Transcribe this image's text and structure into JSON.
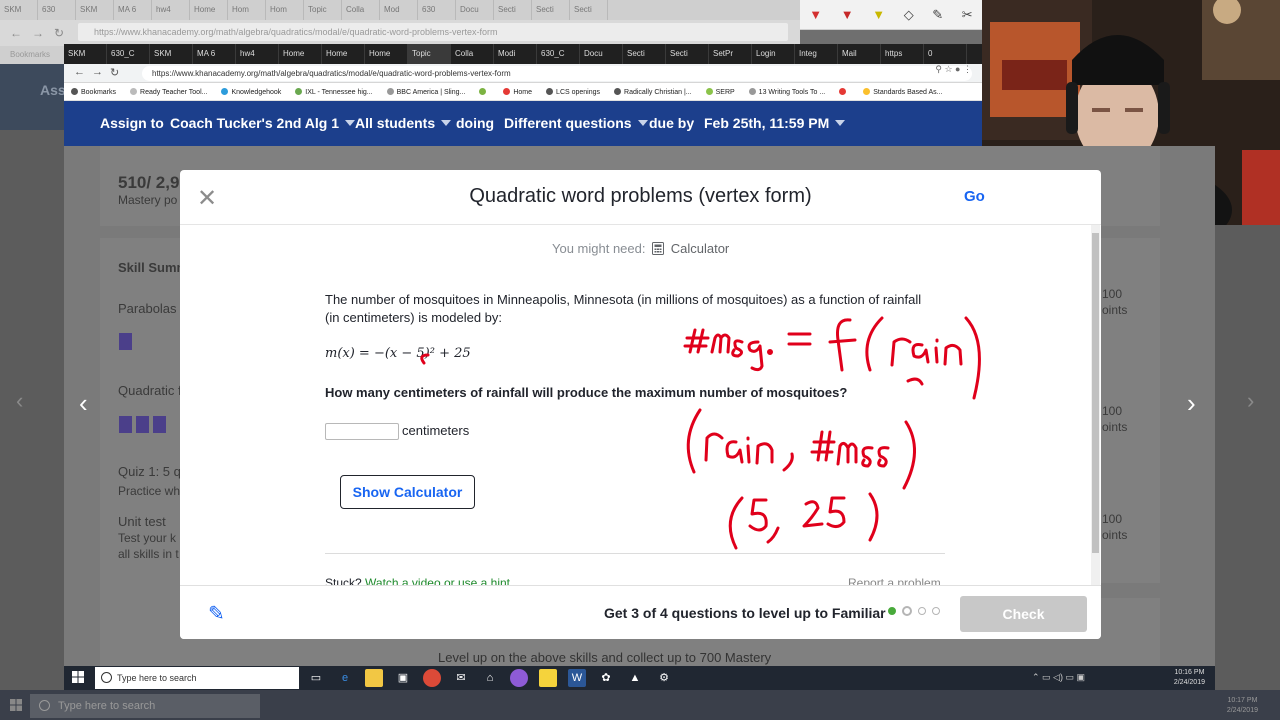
{
  "outer_browser": {
    "tabs": [
      "SKM",
      "630",
      "SKM",
      "MA 6",
      "hw4",
      "Home",
      "Hom",
      "Hom",
      "Topic",
      "Colla",
      "Mod",
      "630",
      "Docu",
      "Secti",
      "Secti",
      "Secti"
    ],
    "url": "https://www.khanacademy.org/math/algebra/quadratics/modal/e/quadratic-word-problems-vertex-form",
    "bookmarks_label": "Bookmarks",
    "left_logo_text": "Ass"
  },
  "browser": {
    "tabs": [
      "SKM",
      "630_C",
      "SKM",
      "MA 6",
      "hw4",
      "Home",
      "Home",
      "Home",
      "Topic",
      "Colla",
      "Modi",
      "630_C",
      "Docu",
      "Secti",
      "Secti",
      "SetPr",
      "Login",
      "Integ",
      "Mail",
      "https",
      "0"
    ],
    "url": "https://www.khanacademy.org/math/algebra/quadratics/modal/e/quadratic-word-problems-vertex-form",
    "bookmarks": [
      {
        "label": "Bookmarks",
        "color": "#555555"
      },
      {
        "label": "Ready Teacher Tool...",
        "color": "#bbbbbb"
      },
      {
        "label": "Knowledgehook",
        "color": "#2d9cdb"
      },
      {
        "label": "IXL - Tennessee hig...",
        "color": "#6aa84f"
      },
      {
        "label": "BBC America | Sling...",
        "color": "#999999"
      },
      {
        "label": "",
        "color": "#7cb342"
      },
      {
        "label": "Home",
        "color": "#e53935"
      },
      {
        "label": "LCS openings",
        "color": "#555555"
      },
      {
        "label": "Radically Christian |...",
        "color": "#555555"
      },
      {
        "label": "SERP",
        "color": "#8bc34a"
      },
      {
        "label": "13 Writing Tools To ...",
        "color": "#999999"
      },
      {
        "label": "",
        "color": "#e53935"
      },
      {
        "label": "Standards Based As...",
        "color": "#fbc02d"
      }
    ]
  },
  "assign_bar": {
    "assign_to": "Assign to",
    "class_name": "Coach Tucker's 2nd Alg 1",
    "students": "All students",
    "doing": "doing",
    "questions": "Different questions",
    "due_by": "due by",
    "due_date": "Feb 25th, 11:59 PM"
  },
  "background_page": {
    "mastery_points": "510/ 2,9",
    "mastery_sub": "Mastery po",
    "skill_summary": "Skill Summ",
    "parabolas": "Parabolas i",
    "quadratic": "Quadratic f",
    "quiz": "Quiz 1: 5 q",
    "quiz_sub": "Practice wh",
    "unit_test": "Unit test",
    "unit_test_sub1": "Test your k",
    "unit_test_sub2": "all skills in t",
    "right_pts": [
      "100",
      "oints",
      "100",
      "oints",
      "100",
      "oints"
    ],
    "level_up_text": "Level up on the above skills and collect up to 700 Mastery"
  },
  "modal": {
    "title": "Quadratic word problems (vertex form)",
    "go_label": "Go",
    "you_might_need": "You might need:",
    "calculator": "Calculator",
    "problem_text": "The number of mosquitoes in Minneapolis, Minnesota (in millions of mosquitoes) as a function of rainfall (in centimeters) is modeled by:",
    "formula_text": "m(x) = −(x − 5)² + 25",
    "question": "How many centimeters of rainfall will produce the maximum number of mosquitoes?",
    "answer_value": "",
    "unit": "centimeters",
    "show_calculator": "Show Calculator",
    "stuck": "Stuck?",
    "hint_link": "Watch a video or use a hint",
    "report": "Report a problem",
    "level_up": "Get 3 of 4 questions to level up to Familiar",
    "progress": {
      "completed": 1,
      "total": 4
    },
    "check": "Check"
  },
  "annotations": {
    "line1": "#mosq. = f(rain)",
    "line2": "(rain, #mosq)",
    "line3": "(5, 25)",
    "color": "#e0001b"
  },
  "taskbar": {
    "search_placeholder": "Type here to search",
    "time": "10:16 PM",
    "date": "2/24/2019",
    "outer_time": "10:17 PM",
    "outer_date": "2/24/2019"
  },
  "colors": {
    "khan_blue": "#1c3f8c",
    "link_blue": "#1865f2",
    "hint_green": "#1e8a2c"
  },
  "icons": [
    "close-icon",
    "calculator-icon",
    "pencil-icon",
    "chevron-left-icon",
    "chevron-right-icon",
    "windows-start-icon",
    "search-icon"
  ]
}
